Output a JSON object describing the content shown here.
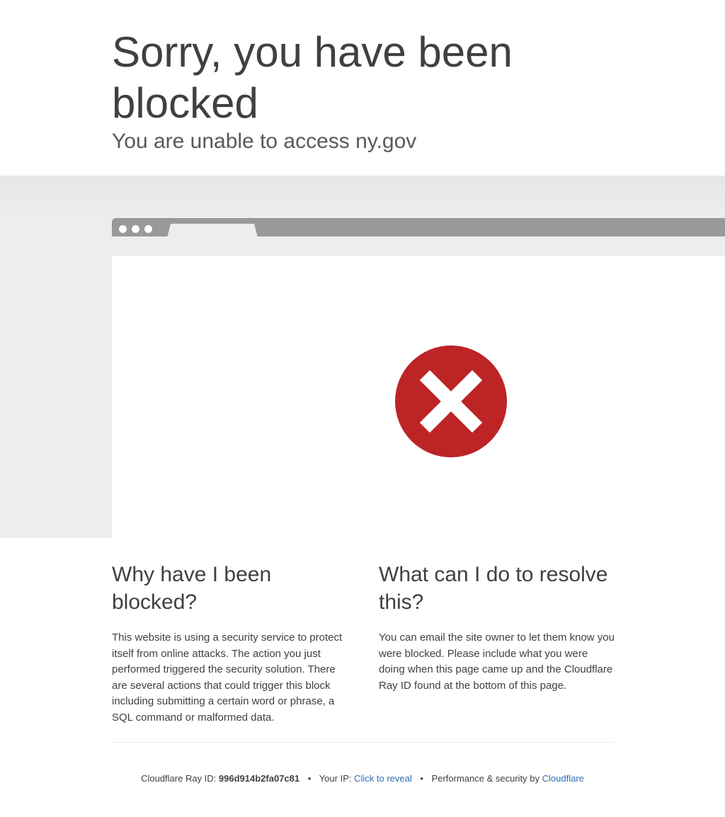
{
  "header": {
    "title": "Sorry, you have been blocked",
    "subtitle": "You are unable to access ny.gov"
  },
  "icons": {
    "block_icon": "error-x-icon",
    "block_color": "#bd2426"
  },
  "why": {
    "heading": "Why have I been blocked?",
    "body": "This website is using a security service to protect itself from online attacks. The action you just performed triggered the security solution. There are several actions that could trigger this block including submitting a certain word or phrase, a SQL command or malformed data."
  },
  "resolve": {
    "heading": "What can I do to resolve this?",
    "body": "You can email the site owner to let them know you were blocked. Please include what you were doing when this page came up and the Cloudflare Ray ID found at the bottom of this page."
  },
  "footer": {
    "ray_label": "Cloudflare Ray ID:",
    "ray_id": "996d914b2fa07c81",
    "separator": "•",
    "ip_label": "Your IP:",
    "ip_link": "Click to reveal",
    "perf_label": "Performance & security by",
    "brand_link": "Cloudflare",
    "link_color": "#2f6eb6"
  }
}
